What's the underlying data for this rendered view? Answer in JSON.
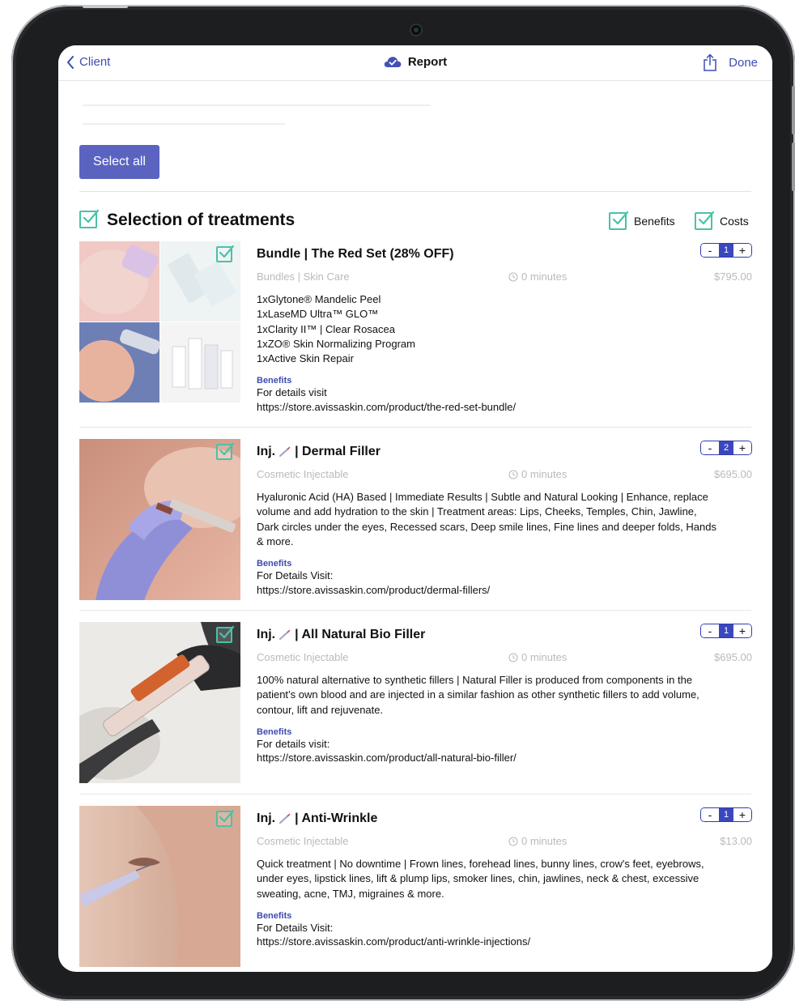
{
  "nav": {
    "back_label": "Client",
    "title": "Report",
    "done_label": "Done"
  },
  "toolbar": {
    "select_all_label": "Select all"
  },
  "section": {
    "title": "Selection of treatments",
    "toggles": {
      "benefits_label": "Benefits",
      "costs_label": "Costs"
    }
  },
  "items": [
    {
      "title": "Bundle | The Red Set (28% OFF)",
      "category": "Bundles | Skin Care",
      "duration": "0 minutes",
      "price": "$795.00",
      "quantity": "1",
      "description": "1xGlytone® Mandelic Peel\n1xLaseMD Ultra™ GLO™\n1xClarity II™ | Clear Rosacea\n1xZO® Skin Normalizing Program\n1xActive Skin Repair",
      "benefits_label": "Benefits",
      "benefits_text": "For details visit\nhttps://store.avissaskin.com/product/the-red-set-bundle/"
    },
    {
      "title_prefix": "Inj.",
      "title": "| Dermal Filler",
      "category": "Cosmetic Injectable",
      "duration": "0 minutes",
      "price": "$695.00",
      "quantity": "2",
      "description": "Hyaluronic Acid (HA) Based | Immediate Results | Subtle and Natural Looking | Enhance, replace\nvolume and add hydration to the skin | Treatment areas: Lips, Cheeks, Temples, Chin, Jawline,\nDark circles under the eyes, Recessed scars, Deep smile lines, Fine lines and deeper folds, Hands\n& more.",
      "benefits_label": "Benefits",
      "benefits_text": "For Details Visit:\nhttps://store.avissaskin.com/product/dermal-fillers/"
    },
    {
      "title_prefix": "Inj.",
      "title": "| All Natural Bio Filler",
      "category": "Cosmetic Injectable",
      "duration": "0 minutes",
      "price": "$695.00",
      "quantity": "1",
      "description": "100% natural alternative to synthetic fillers | Natural Filler is produced from components in the\npatient’s own blood and are injected in a similar fashion as other synthetic fillers to add volume,\ncontour, lift and rejuvenate.",
      "benefits_label": "Benefits",
      "benefits_text": "For details visit:\nhttps://store.avissaskin.com/product/all-natural-bio-filler/"
    },
    {
      "title_prefix": "Inj.",
      "title": "| Anti-Wrinkle",
      "category": "Cosmetic Injectable",
      "duration": "0 minutes",
      "price": "$13.00",
      "quantity": "1",
      "description": "Quick treatment | No downtime | Frown lines, forehead lines, bunny lines, crow's feet, eyebrows,\nunder eyes, lipstick lines, lift & plump lips, smoker lines, chin, jawlines, neck & chest, excessive\nsweating, acne, TMJ, migraines & more.",
      "benefits_label": "Benefits",
      "benefits_text": "For Details Visit:\nhttps://store.avissaskin.com/product/anti-wrinkle-injections/"
    }
  ],
  "stepper": {
    "minus": "-",
    "plus": "+"
  },
  "colors": {
    "accent": "#3e4bb0",
    "check": "#48c2a9",
    "button": "#5a64c0"
  }
}
